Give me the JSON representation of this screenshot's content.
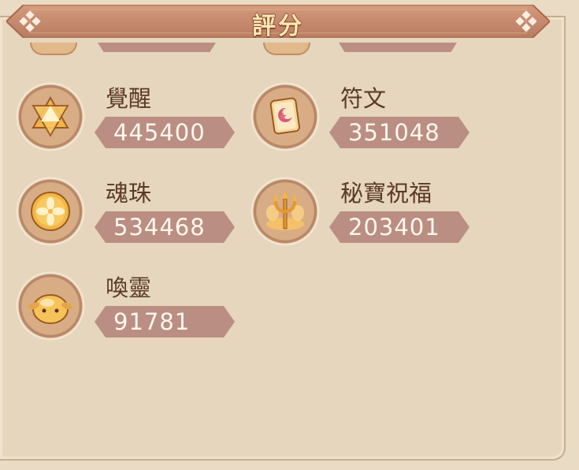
{
  "header": {
    "title": "評分"
  },
  "items": [
    {
      "name": "覺醒",
      "value": "445400",
      "icon": "hexagram-icon"
    },
    {
      "name": "符文",
      "value": "351048",
      "icon": "rune-tablet-icon"
    },
    {
      "name": "魂珠",
      "value": "534468",
      "icon": "soul-orb-icon"
    },
    {
      "name": "秘寶祝福",
      "value": "203401",
      "icon": "trident-icon"
    },
    {
      "name": "喚靈",
      "value": "91781",
      "icon": "spirit-creature-icon"
    }
  ],
  "colors": {
    "panel": "#e6d6bd",
    "banner": "#c48b6d",
    "value_bar": "#bb8e83",
    "label_text": "#5b3a27",
    "value_text": "#fff7ec"
  }
}
